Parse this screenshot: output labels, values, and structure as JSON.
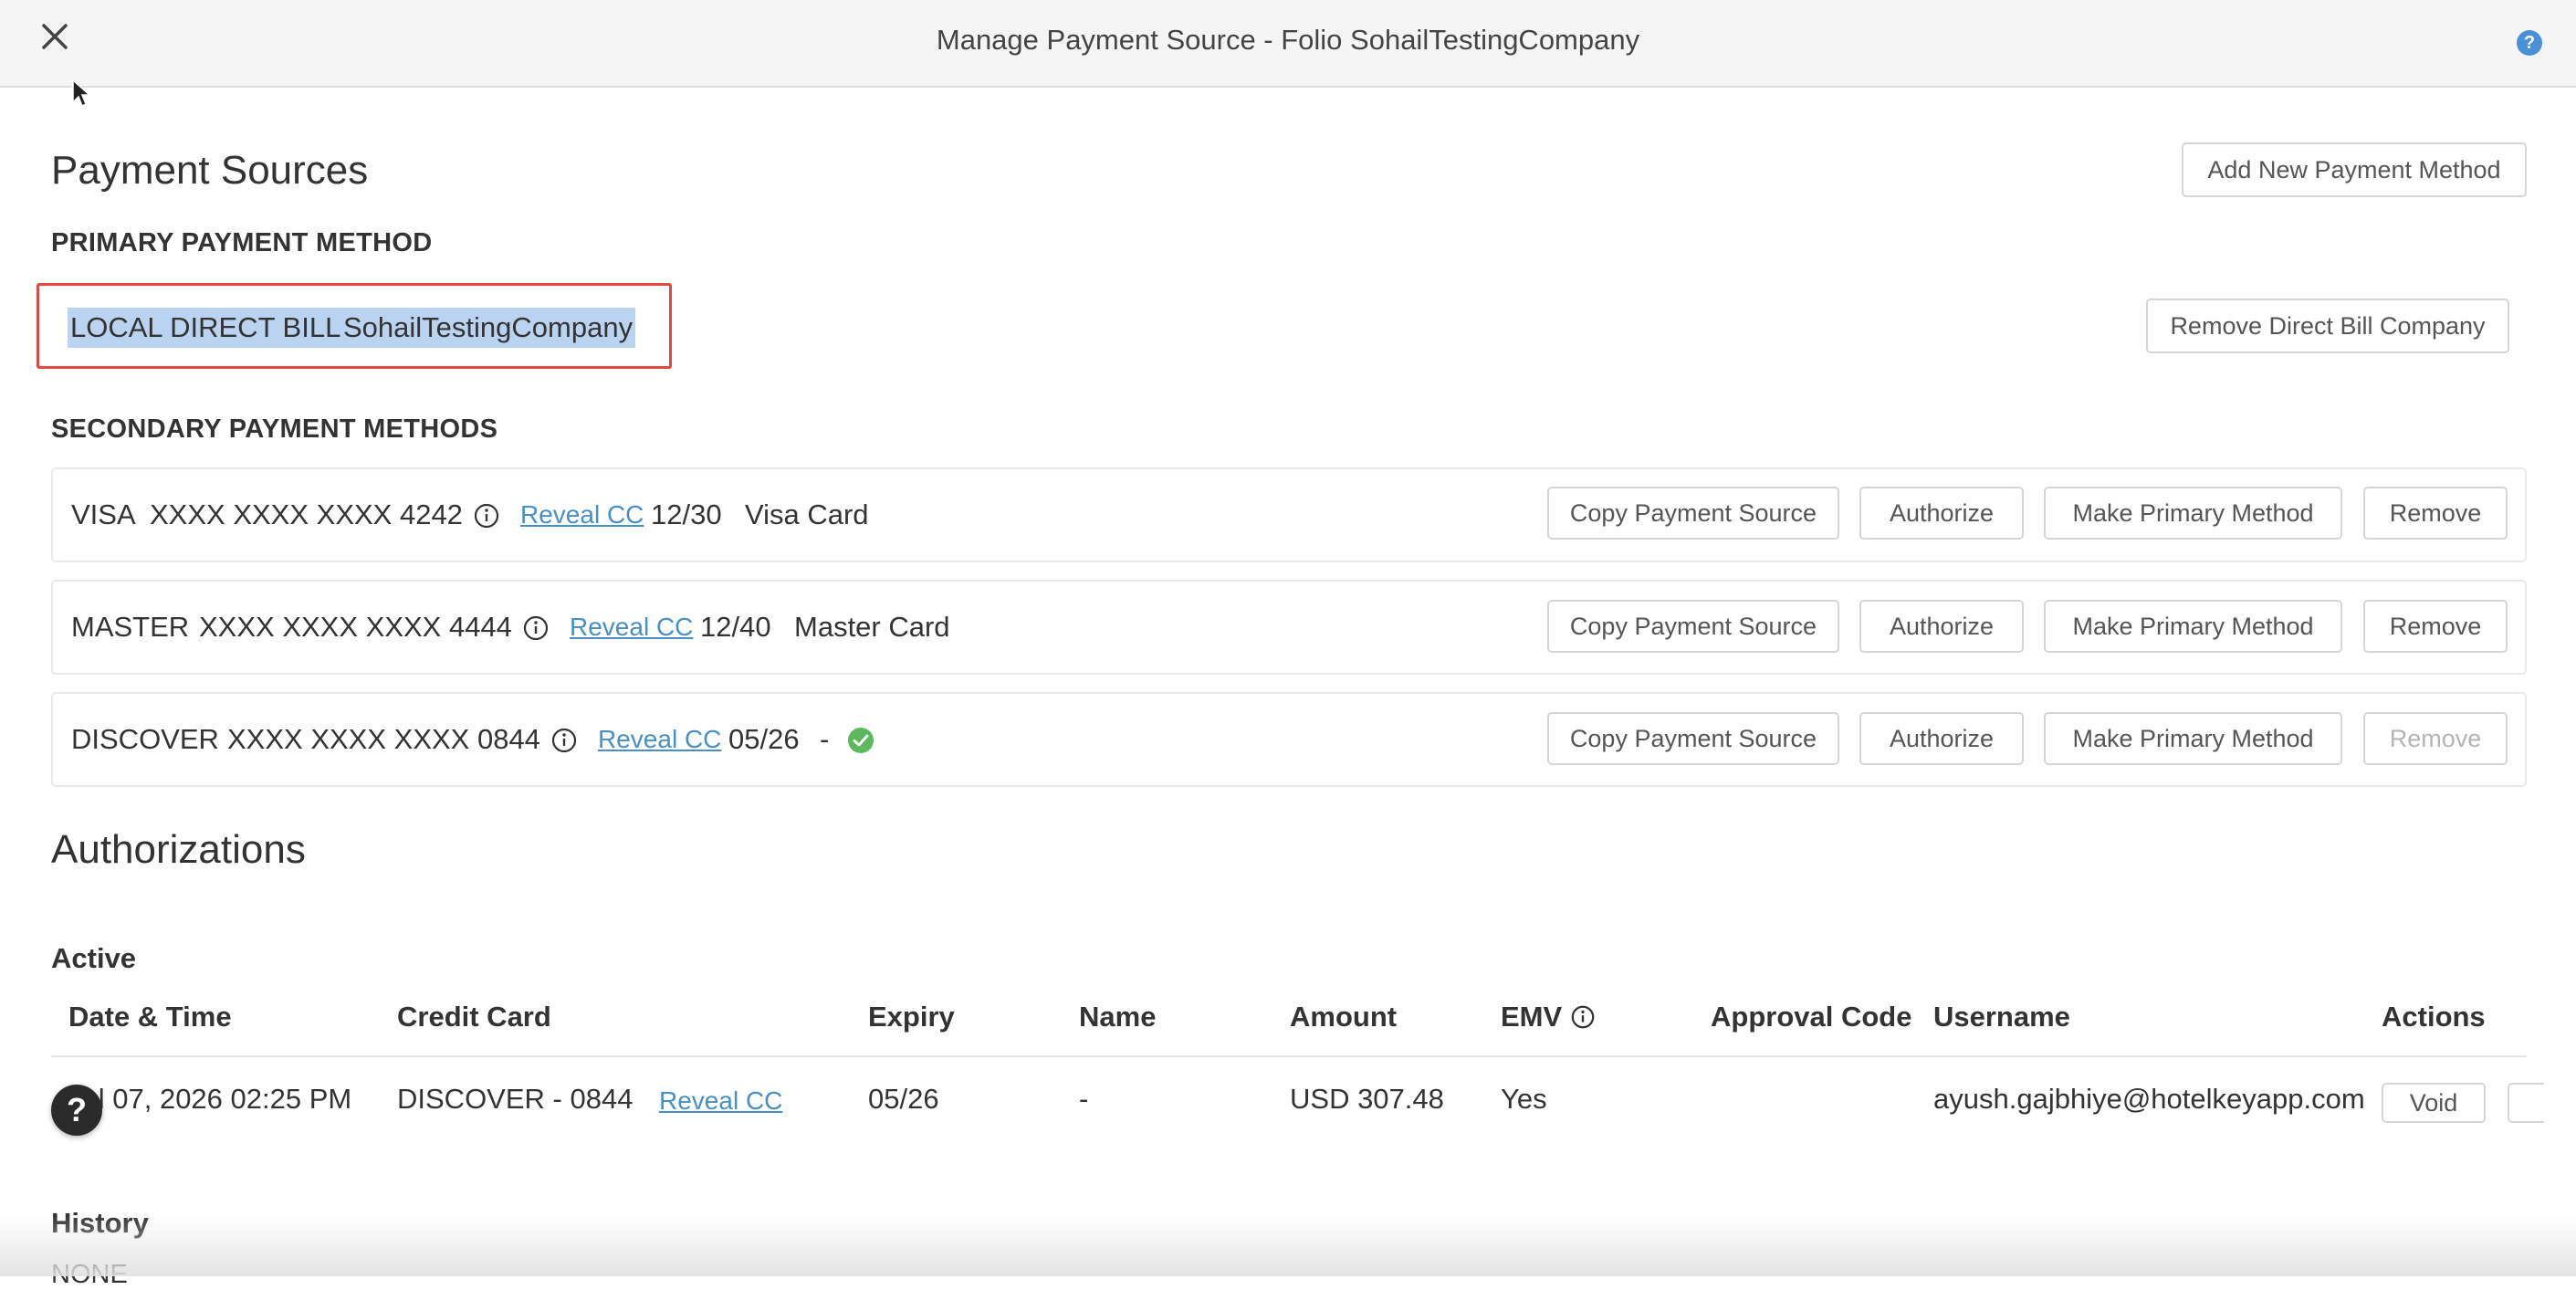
{
  "header": {
    "title": "Manage Payment Source - Folio SohailTestingCompany",
    "close_icon": "close-icon",
    "help_icon": "help-icon",
    "help_glyph": "?"
  },
  "payment_sources": {
    "title": "Payment Sources",
    "add_button": "Add New Payment Method",
    "primary_heading": "PRIMARY PAYMENT METHOD",
    "primary_type": "LOCAL DIRECT BILL",
    "primary_company": "SohailTestingCompany",
    "remove_direct_bill_button": "Remove Direct Bill Company",
    "secondary_heading": "SECONDARY PAYMENT METHODS",
    "secondary": [
      {
        "brand": "VISA",
        "number": "XXXX XXXX XXXX 4242",
        "reveal": "Reveal CC",
        "expiry": "12/30",
        "label": "Visa Card",
        "copy": "Copy Payment Source",
        "authorize": "Authorize",
        "make_primary": "Make Primary Method",
        "remove": "Remove"
      },
      {
        "brand": "MASTER",
        "number": "XXXX XXXX XXXX 4444",
        "reveal": "Reveal CC",
        "expiry": "12/40",
        "label": "Master Card",
        "copy": "Copy Payment Source",
        "authorize": "Authorize",
        "make_primary": "Make Primary Method",
        "remove": "Remove"
      },
      {
        "brand": "DISCOVER",
        "number": "XXXX XXXX XXXX 0844",
        "reveal": "Reveal CC",
        "expiry": "05/26",
        "label": "-",
        "copy": "Copy Payment Source",
        "authorize": "Authorize",
        "make_primary": "Make Primary Method",
        "remove": "Remove",
        "remove_disabled": true,
        "verified_icon": "check-circle-icon"
      }
    ]
  },
  "authorizations": {
    "title": "Authorizations",
    "active_heading": "Active",
    "columns": [
      "Date & Time",
      "Credit Card",
      "Expiry",
      "Name",
      "Amount",
      "EMV",
      "Approval Code",
      "Username",
      "Actions"
    ],
    "rows": [
      {
        "date_time": "Jul 07, 2026 02:25 PM",
        "credit_card": "DISCOVER - 0844",
        "reveal": "Reveal CC",
        "expiry": "05/26",
        "name": "-",
        "amount": "USD 307.48",
        "emv": "Yes",
        "approval_code": "",
        "username": "ayush.gajbhiye@hotelkeyapp.com",
        "void": "Void"
      }
    ],
    "history_heading": "History",
    "history_value": "NONE"
  },
  "floating_help": "?",
  "colors": {
    "accent_link": "#4a8fc4",
    "highlight_border": "#e2483d",
    "selection": "#b9d3f0",
    "success": "#5cb85c",
    "help_badge": "#4a90d9"
  }
}
